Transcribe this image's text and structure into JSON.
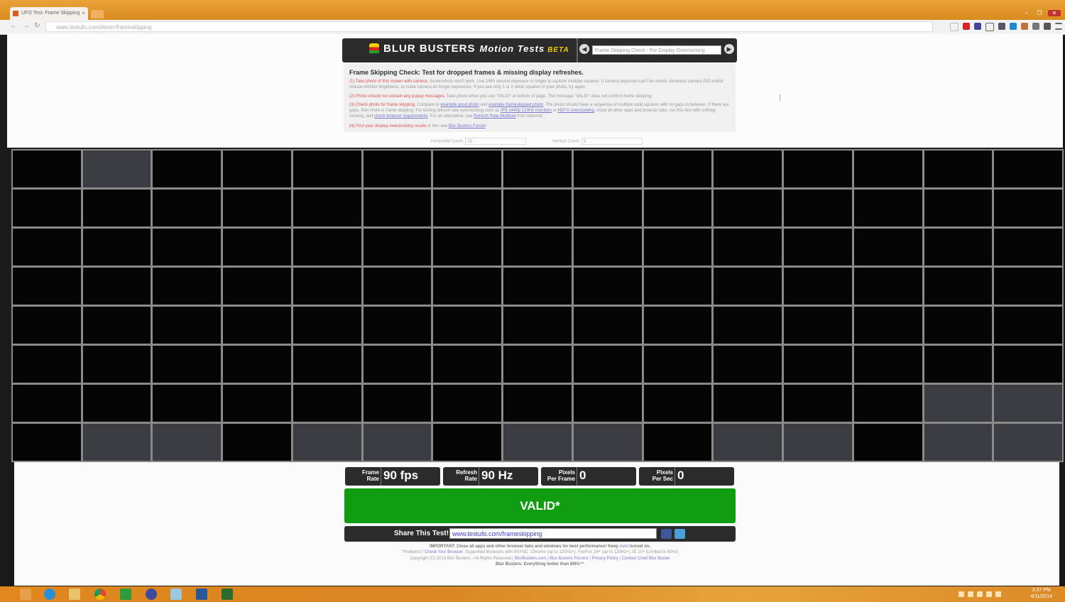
{
  "browser": {
    "tab_title": "UFO Test: Frame Skipping",
    "tab_close": "×",
    "url": "www.testufo.com/#test=frameskipping",
    "back": "←",
    "forward": "→",
    "reload": "↻"
  },
  "header": {
    "brand": "BLUR BUSTERS",
    "motion": "Motion Tests",
    "beta": "BETA",
    "prev": "◀",
    "next": "▶",
    "test_select": "Frame Skipping Check - For Display Overclocking"
  },
  "info": {
    "title": "Frame Skipping Check:  Test for dropped frames & missing display refreshes.",
    "step1_red": "(1) Take photo of this screen with camera.",
    "step1_text": " Screenshots won't work. Use 1/6th second exposure or longer to capture multiple squares. If camera exposure can't be raised, decrease camera ISO and/or reduce monitor brightness, to make camera do longer exposures. If you see only 1 or 2 white squares in your photo, try again.",
    "step2_red": "(2) Photo should not contain any popup messages.",
    "step2_text": " Take photo when you see \"VALID\" at bottom of page. The message \"VALID\" does not confirm frame skipping.",
    "step3_red": "(3) Check photo for frame skipping.",
    "step3_a": " Compare to ",
    "step3_link1": "example good photo",
    "step3_b": " and ",
    "step3_link2": "example frameskipped photo",
    "step3_c": ". The photo should have a sequence of multiple solid squares with no gaps in between. If there are gaps, then there is frame skipping. For testing refresh rate overclocking such as ",
    "step3_link3": "IPS 1440p 120Hz monitors",
    "step3_d": " or ",
    "step3_link4": "HDTV overclocking",
    "step3_e": ", close all other apps and browser tabs, run this test with nothing running, and ",
    "step3_link5": "check browser requirements",
    "step3_f": ". For an alternative, see ",
    "step3_link6": "Refresh Rate Multitool",
    "step3_g": " from shanrod.",
    "step4_red": "(4) Post your display overclocking results",
    "step4_text": " in the new ",
    "step4_link": "Blur Busters Forum",
    "step4_end": "!",
    "horizontal_label": "Horizontal Count:",
    "horizontal_value": "15",
    "vertical_label": "Vertical Count:",
    "vertical_value": "8"
  },
  "grid": {
    "columns": 15,
    "rows": 8,
    "lit_cells": [
      [
        0,
        1
      ],
      [
        6,
        13
      ],
      [
        6,
        14
      ],
      [
        7,
        1
      ],
      [
        7,
        2
      ],
      [
        7,
        4
      ],
      [
        7,
        5
      ],
      [
        7,
        7
      ],
      [
        7,
        8
      ],
      [
        7,
        10
      ],
      [
        7,
        11
      ],
      [
        7,
        13
      ],
      [
        7,
        14
      ]
    ],
    "colors": {
      "off": "#050505",
      "on": "#3a3c42",
      "border": "#8a8a8a"
    }
  },
  "stats": [
    {
      "label_line1": "Frame",
      "label_line2": "Rate",
      "value": "90 fps"
    },
    {
      "label_line1": "Refresh",
      "label_line2": "Rate",
      "value": "90 Hz"
    },
    {
      "label_line1": "Pixels",
      "label_line2": "Per Frame",
      "value": "0"
    },
    {
      "label_line1": "Pixels",
      "label_line2": "Per Sec",
      "value": "0"
    }
  ],
  "status": {
    "text": "VALID*",
    "color": "#119d11"
  },
  "share": {
    "label": "Share This Test!",
    "url": "www.testufo.com/frameskipping"
  },
  "footer": {
    "important": "IMPORTANT: Close all apps and other browser tabs and windows for best performance! Keep ",
    "aero": "Aero",
    "important_end": " turned on.",
    "problems": "\"Problems? ",
    "check_browser": "Check Your Browser",
    "supported": ". Supported Browsers with VSYNC: Chrome (up to 120Hz+), FireFox 24+ (up to 120Hz+), IE 10+ (Limited to 60Hz)",
    "copyright": "Copyright (C) 2013 Blur Busters - All Rights Reserved | ",
    "link_bb": "BlurBusters.com",
    "sep1": " | ",
    "link_forums": "Blur Busters Forums",
    "sep2": " | ",
    "link_privacy": "Privacy Policy",
    "sep3": " | ",
    "link_contact": "Contact Chief Blur Buster",
    "tagline": "Blur Busters: Everything better than 60Hz™"
  },
  "taskbar": {
    "time": "3:37 PM",
    "date": "4/11/2014"
  }
}
